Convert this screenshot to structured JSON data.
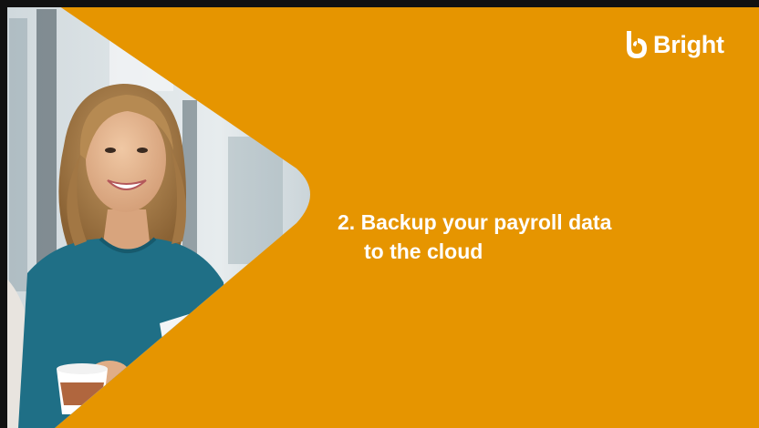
{
  "slide": {
    "brand": {
      "name": "Bright",
      "logo_icon": "bright-b-icon",
      "color": "#ffffff"
    },
    "headline": {
      "line1": "2. Backup your payroll data",
      "line2": "to the cloud"
    },
    "colors": {
      "background": "#e69500",
      "text": "#ffffff",
      "sweater": "#1f6f86"
    }
  }
}
